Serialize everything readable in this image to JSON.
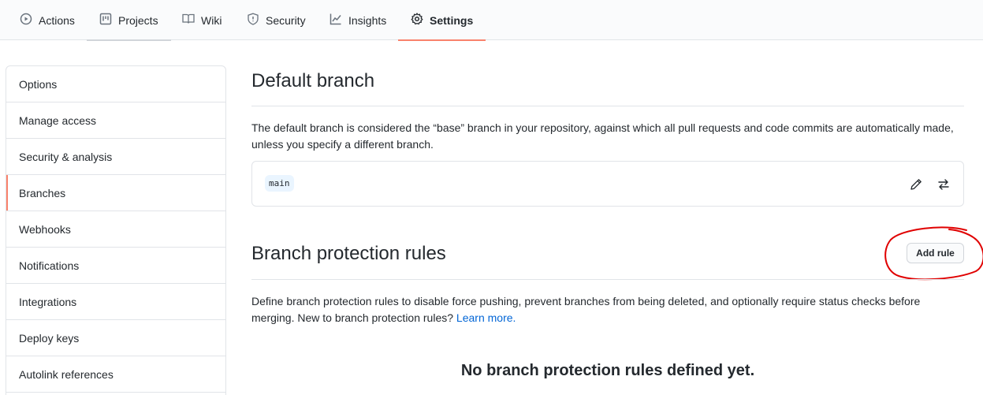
{
  "tabs": [
    {
      "label": "Actions",
      "icon": "play-icon"
    },
    {
      "label": "Projects",
      "icon": "project-icon"
    },
    {
      "label": "Wiki",
      "icon": "book-icon"
    },
    {
      "label": "Security",
      "icon": "shield-icon"
    },
    {
      "label": "Insights",
      "icon": "graph-icon"
    },
    {
      "label": "Settings",
      "icon": "gear-icon",
      "active": true
    }
  ],
  "sidebar": {
    "items": [
      {
        "label": "Options"
      },
      {
        "label": "Manage access"
      },
      {
        "label": "Security & analysis"
      },
      {
        "label": "Branches",
        "selected": true
      },
      {
        "label": "Webhooks"
      },
      {
        "label": "Notifications"
      },
      {
        "label": "Integrations"
      },
      {
        "label": "Deploy keys"
      },
      {
        "label": "Autolink references"
      }
    ]
  },
  "default_branch": {
    "title": "Default branch",
    "description": "The default branch is considered the “base” branch in your repository, against which all pull requests and code commits are automatically made, unless you specify a different branch.",
    "branch_name": "main",
    "edit_icon": "pencil-icon",
    "switch_icon": "arrow-switch-icon"
  },
  "protection": {
    "title": "Branch protection rules",
    "add_rule_label": "Add rule",
    "description": "Define branch protection rules to disable force pushing, prevent branches from being deleted, and optionally require status checks before merging. New to branch protection rules?",
    "learn_more": "Learn more.",
    "empty_title": "No branch protection rules defined yet."
  },
  "colors": {
    "accent": "#f9826c",
    "link": "#0366d6",
    "annotation": "#e00000"
  }
}
